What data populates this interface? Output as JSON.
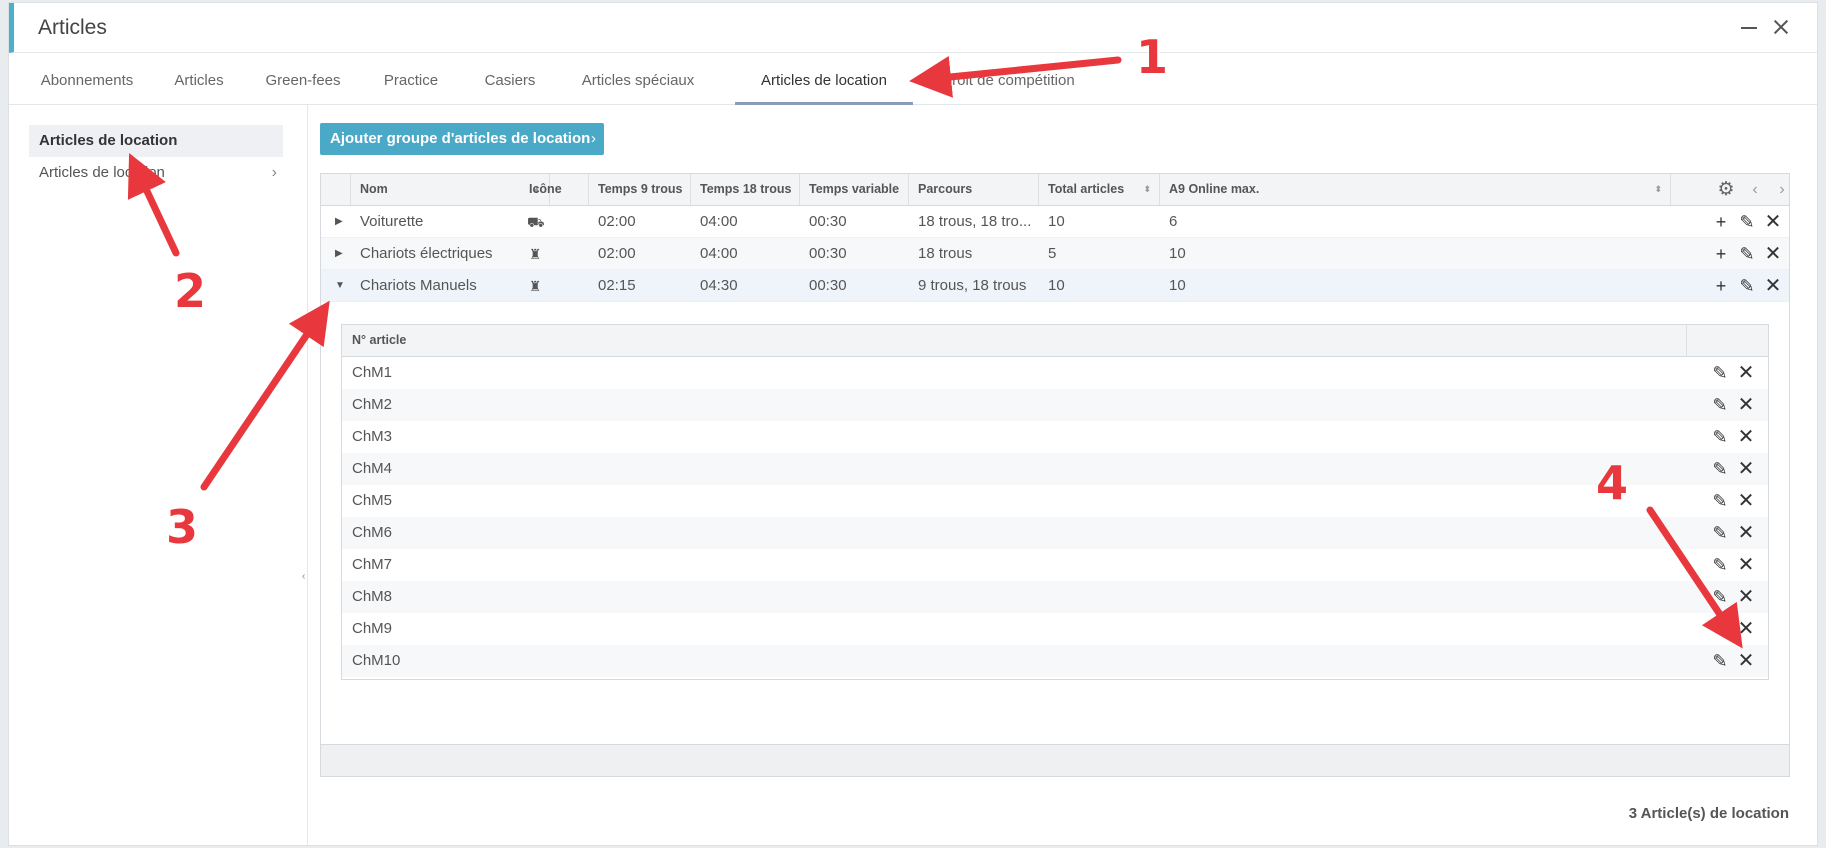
{
  "window": {
    "title": "Articles"
  },
  "tabs": [
    {
      "label": "Abonnements"
    },
    {
      "label": "Articles"
    },
    {
      "label": "Green-fees"
    },
    {
      "label": "Practice"
    },
    {
      "label": "Casiers"
    },
    {
      "label": "Articles spéciaux"
    },
    {
      "label": "Articles de location"
    },
    {
      "label": "Droit de compétition"
    }
  ],
  "sidebar": {
    "items": [
      {
        "label": "Articles de location"
      },
      {
        "label": "Articles de location"
      }
    ]
  },
  "toolbar": {
    "add_button": "Ajouter groupe d'articles de location"
  },
  "grid": {
    "columns": [
      "Nom",
      "Icône",
      "Temps 9 trous",
      "Temps 18 trous",
      "Temps variable",
      "Parcours",
      "Total articles",
      "A9 Online max."
    ],
    "rows": [
      {
        "nom": "Voiturette",
        "icon": "golf-cart-icon",
        "t9": "02:00",
        "t18": "04:00",
        "tvar": "00:30",
        "parcours": "18 trous, 18 tro...",
        "total": "10",
        "max": "6"
      },
      {
        "nom": "Chariots électriques",
        "icon": "golf-trolley-icon",
        "t9": "02:00",
        "t18": "04:00",
        "tvar": "00:30",
        "parcours": "18 trous",
        "total": "5",
        "max": "10"
      },
      {
        "nom": "Chariots Manuels",
        "icon": "golf-trolley-icon",
        "t9": "02:15",
        "t18": "04:30",
        "tvar": "00:30",
        "parcours": "9 trous, 18 trous",
        "total": "10",
        "max": "10"
      }
    ]
  },
  "subgrid": {
    "column": "N° article",
    "items": [
      "ChM1",
      "ChM2",
      "ChM3",
      "ChM4",
      "ChM5",
      "ChM6",
      "ChM7",
      "ChM8",
      "ChM9",
      "ChM10"
    ]
  },
  "status": "3 Article(s) de location",
  "annotations": {
    "n1": "1",
    "n2": "2",
    "n3": "3",
    "n4": "4",
    "color": "#e8383d"
  }
}
